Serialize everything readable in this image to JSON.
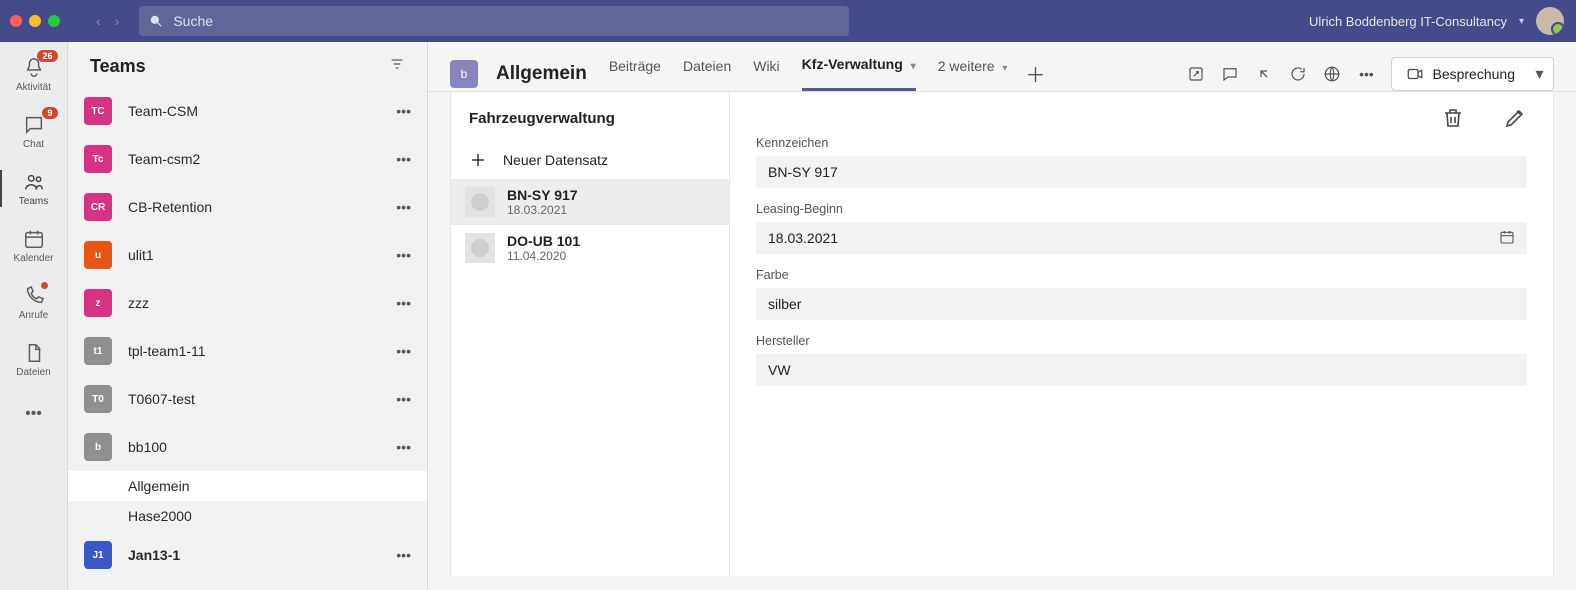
{
  "titlebar": {
    "search_placeholder": "Suche",
    "org_name": "Ulrich Boddenberg IT-Consultancy"
  },
  "rail": {
    "items": [
      {
        "key": "activity",
        "label": "Aktivität",
        "badge": "26"
      },
      {
        "key": "chat",
        "label": "Chat",
        "badge": "9"
      },
      {
        "key": "teams",
        "label": "Teams",
        "active": true
      },
      {
        "key": "calendar",
        "label": "Kalender"
      },
      {
        "key": "calls",
        "label": "Anrufe",
        "dot": true
      },
      {
        "key": "files",
        "label": "Dateien"
      }
    ]
  },
  "teams_pane": {
    "heading": "Teams",
    "teams": [
      {
        "label": "Team-CSM",
        "initials": "TC",
        "color": "#d63384"
      },
      {
        "label": "Team-csm2",
        "initials": "Tc",
        "color": "#d63384"
      },
      {
        "label": "CB-Retention",
        "initials": "CR",
        "color": "#d63384"
      },
      {
        "label": "ulit1",
        "initials": "u",
        "color": "#e85617"
      },
      {
        "label": "zzz",
        "initials": "z",
        "color": "#d63384"
      },
      {
        "label": "tpl-team1-11",
        "initials": "t1",
        "color": "#8f8f8f"
      },
      {
        "label": "T0607-test",
        "initials": "T0",
        "color": "#8f8f8f"
      },
      {
        "label": "bb100",
        "initials": "b",
        "color": "#8f8f8f",
        "channels": [
          {
            "label": "Allgemein",
            "selected": true
          },
          {
            "label": "Hase2000"
          }
        ]
      },
      {
        "label": "Jan13-1",
        "initials": "J1",
        "color": "#3a57c8",
        "bold": true
      }
    ]
  },
  "channel": {
    "avatar_initial": "b",
    "title": "Allgemein",
    "tabs": [
      {
        "label": "Beiträge"
      },
      {
        "label": "Dateien"
      },
      {
        "label": "Wiki"
      },
      {
        "label": "Kfz-Verwaltung",
        "active": true,
        "chevron": true
      },
      {
        "label": "2 weitere",
        "chevron": true
      }
    ],
    "meet_button": "Besprechung"
  },
  "app": {
    "list_heading": "Fahrzeugverwaltung",
    "new_label": "Neuer Datensatz",
    "records": [
      {
        "title": "BN-SY 917",
        "sub": "18.03.2021",
        "selected": true
      },
      {
        "title": "DO-UB 101",
        "sub": "11.04.2020"
      }
    ],
    "fields": {
      "kennzeichen": {
        "label": "Kennzeichen",
        "value": "BN-SY 917"
      },
      "leasing": {
        "label": "Leasing-Beginn",
        "value": "18.03.2021",
        "date": true
      },
      "farbe": {
        "label": "Farbe",
        "value": "silber"
      },
      "hersteller": {
        "label": "Hersteller",
        "value": "VW"
      }
    }
  }
}
